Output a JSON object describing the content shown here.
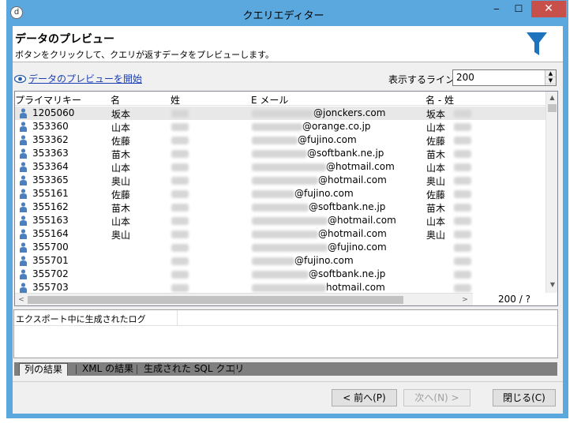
{
  "window": {
    "title": "クエリエディター",
    "minimize": "‒",
    "maximize": "☐",
    "close": "✕",
    "app_icon_glyph": "d"
  },
  "header": {
    "title": "データのプレビュー",
    "subtitle": "ボタンをクリックして、クエリが返すデータをプレビューします。"
  },
  "toolbar": {
    "preview_link": "データのプレビューを開始",
    "lines_label": "表示するライン:",
    "lines_value": "200"
  },
  "grid": {
    "columns": [
      "プライマリキー",
      "名",
      "姓",
      "E メール",
      "名 - 姓"
    ],
    "rows": [
      {
        "id": "1205060",
        "first": "坂本",
        "email_domain": "@jonckers.com",
        "name_combo": "坂本",
        "selected": true
      },
      {
        "id": "353360",
        "first": "山本",
        "email_domain": "@orange.co.jp",
        "name_combo": "山本"
      },
      {
        "id": "353362",
        "first": "佐藤",
        "email_domain": "@fujino.com",
        "name_combo": "佐藤"
      },
      {
        "id": "353363",
        "first": "苗木",
        "email_domain": "@softbank.ne.jp",
        "name_combo": "苗木"
      },
      {
        "id": "353364",
        "first": "山本",
        "email_domain": "@hotmail.com",
        "name_combo": "山本"
      },
      {
        "id": "353365",
        "first": "奥山",
        "email_domain": "@hotmail.com",
        "name_combo": "奥山"
      },
      {
        "id": "355161",
        "first": "佐藤",
        "email_domain": "@fujino.com",
        "name_combo": "佐藤"
      },
      {
        "id": "355162",
        "first": "苗木",
        "email_domain": "@softbank.ne.jp",
        "name_combo": "苗木"
      },
      {
        "id": "355163",
        "first": "山本",
        "email_domain": "@hotmail.com",
        "name_combo": "山本"
      },
      {
        "id": "355164",
        "first": "奥山",
        "email_domain": "@hotmail.com",
        "name_combo": "奥山"
      },
      {
        "id": "355700",
        "first": "",
        "email_domain": "@fujino.com",
        "name_combo": ""
      },
      {
        "id": "355701",
        "first": "",
        "email_domain": "@fujino.com",
        "name_combo": ""
      },
      {
        "id": "355702",
        "first": "",
        "email_domain": "@softbank.ne.jp",
        "name_combo": ""
      },
      {
        "id": "355703",
        "first": "",
        "email_domain": "hotmail.com",
        "name_combo": ""
      }
    ],
    "row_count": "200 / ?"
  },
  "log": {
    "label": "エクスポート中に生成されたログ"
  },
  "tabs": [
    {
      "label": "列の結果",
      "active": true
    },
    {
      "label": "XML の結果",
      "active": false
    },
    {
      "label": "生成された SQL クエリ",
      "active": false
    }
  ],
  "buttons": {
    "prev": "< 前へ(P)",
    "next": "次へ(N) >",
    "close": "閉じる(C)"
  },
  "colors": {
    "titlebar": "#5aa8de",
    "close_button": "#c7504a",
    "funnel": "#1e73be",
    "link": "#1a3fb5",
    "person_icon": "#4a7fc0"
  }
}
